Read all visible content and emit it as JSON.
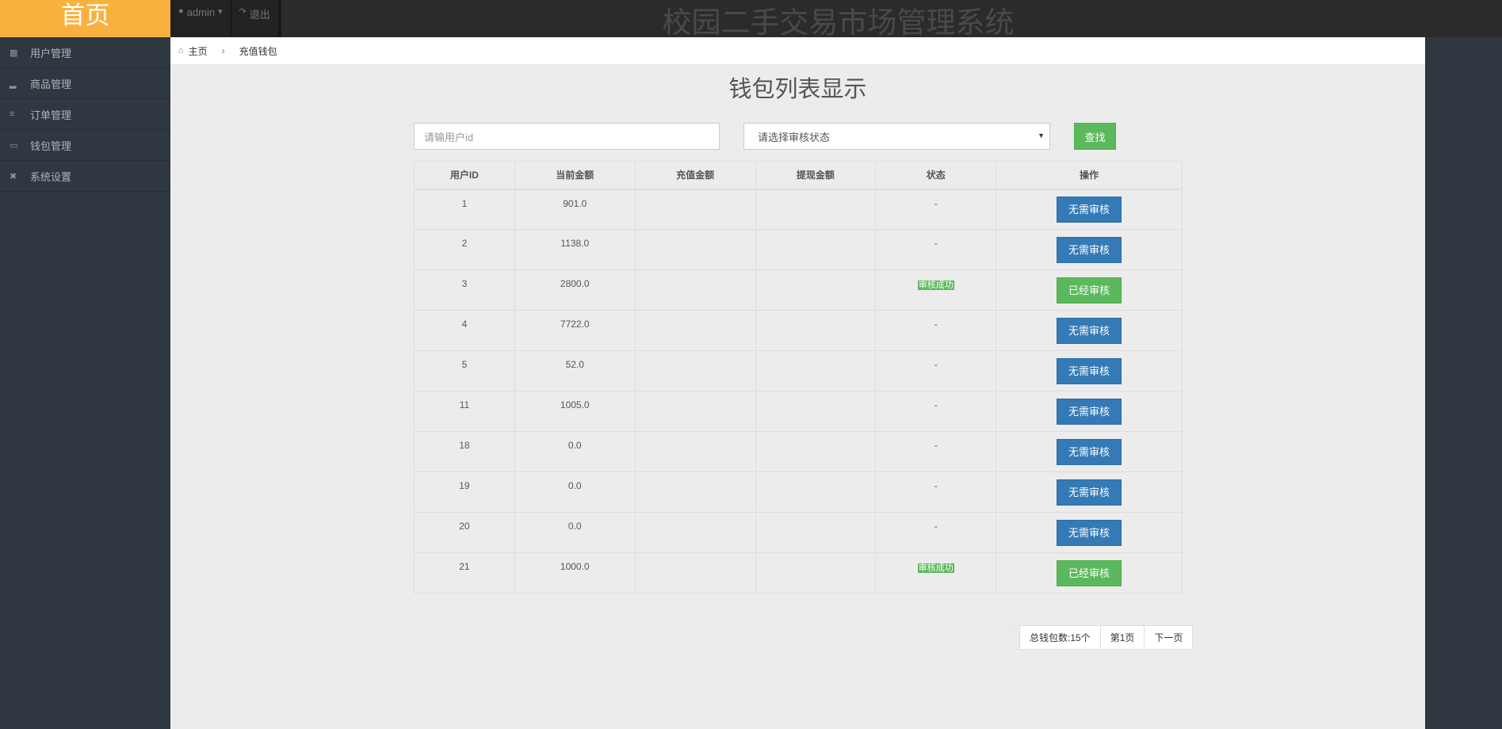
{
  "header": {
    "brand": "首页",
    "user_menu": "admin",
    "logout": "退出",
    "system_title": "校园二手交易市场管理系统"
  },
  "sidebar": {
    "items": [
      {
        "label": "用户管理",
        "icon": "users-icon"
      },
      {
        "label": "商品管理",
        "icon": "signal-icon"
      },
      {
        "label": "订单管理",
        "icon": "list-icon"
      },
      {
        "label": "钱包管理",
        "icon": "inbox-icon"
      },
      {
        "label": "系统设置",
        "icon": "fullscreen-icon"
      }
    ]
  },
  "breadcrumb": {
    "home": "主页",
    "current": "充值钱包"
  },
  "page": {
    "title": "钱包列表显示"
  },
  "search": {
    "placeholder": "请输用户id",
    "status_select": "请选择审核状态",
    "button": "查找"
  },
  "table": {
    "headers": [
      "用户ID",
      "当前金额",
      "充值金额",
      "提现金额",
      "状态",
      "操作"
    ],
    "rows": [
      {
        "id": "1",
        "balance": "901.0",
        "recharge": "",
        "withdraw": "",
        "status": "-",
        "action": "无需审核",
        "action_type": "blue"
      },
      {
        "id": "2",
        "balance": "1138.0",
        "recharge": "",
        "withdraw": "",
        "status": "-",
        "action": "无需审核",
        "action_type": "blue"
      },
      {
        "id": "3",
        "balance": "2800.0",
        "recharge": "",
        "withdraw": "",
        "status": "审核成功",
        "action": "已经审核",
        "action_type": "green"
      },
      {
        "id": "4",
        "balance": "7722.0",
        "recharge": "",
        "withdraw": "",
        "status": "-",
        "action": "无需审核",
        "action_type": "blue"
      },
      {
        "id": "5",
        "balance": "52.0",
        "recharge": "",
        "withdraw": "",
        "status": "-",
        "action": "无需审核",
        "action_type": "blue"
      },
      {
        "id": "11",
        "balance": "1005.0",
        "recharge": "",
        "withdraw": "",
        "status": "-",
        "action": "无需审核",
        "action_type": "blue"
      },
      {
        "id": "18",
        "balance": "0.0",
        "recharge": "",
        "withdraw": "",
        "status": "-",
        "action": "无需审核",
        "action_type": "blue"
      },
      {
        "id": "19",
        "balance": "0.0",
        "recharge": "",
        "withdraw": "",
        "status": "-",
        "action": "无需审核",
        "action_type": "blue"
      },
      {
        "id": "20",
        "balance": "0.0",
        "recharge": "",
        "withdraw": "",
        "status": "-",
        "action": "无需审核",
        "action_type": "blue"
      },
      {
        "id": "21",
        "balance": "1000.0",
        "recharge": "",
        "withdraw": "",
        "status": "审核成功",
        "action": "已经审核",
        "action_type": "green"
      }
    ]
  },
  "pagination": {
    "total": "总钱包数:15个",
    "page": "第1页",
    "next": "下一页"
  },
  "colors": {
    "brand": "#f9b13e",
    "primary": "#337ab7",
    "success": "#5cb85c",
    "sidebar": "#2f3740"
  }
}
